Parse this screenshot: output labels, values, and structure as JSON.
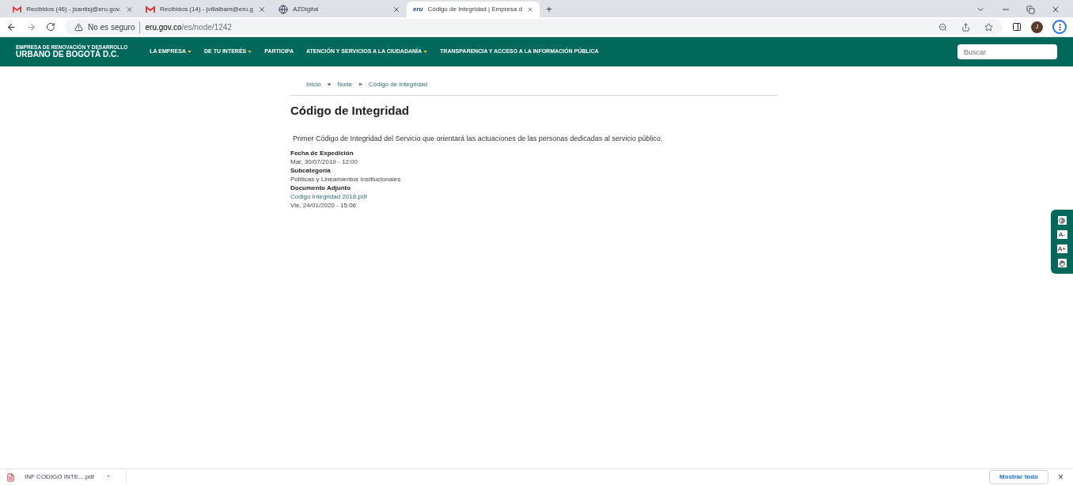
{
  "browser": {
    "tabs": [
      {
        "title": "Recibidos (46) - jsantisj@eru.gov.",
        "kind": "mail",
        "selected": false
      },
      {
        "title": "Recibidos (14) - jvillalbam@eru.g",
        "kind": "mail",
        "selected": false
      },
      {
        "title": "AZDigital",
        "kind": "globe",
        "selected": false
      },
      {
        "title": "Código de Integridad | Empresa d",
        "kind": "site",
        "favicon_text": "eru",
        "selected": true
      }
    ],
    "new_tab": "+",
    "security": "No es seguro",
    "url_host": "eru.gov.co",
    "url_path": "/es/node/1242",
    "avatar": "J"
  },
  "site": {
    "logo_top": "EMPRESA DE RENOVACIÓN Y DESARROLLO",
    "logo_bottom": "URBANO DE BOGOTÁ D.C.",
    "nav": [
      {
        "label": "LA EMPRESA",
        "dropdown": true
      },
      {
        "label": "DE TU INTERÉS",
        "dropdown": true
      },
      {
        "label": "PARTICIPA",
        "dropdown": false
      },
      {
        "label": "ATENCIÓN Y SERVICIOS A LA CIUDADANÍA",
        "dropdown": true
      },
      {
        "label": "TRANSPARENCIA Y ACCESO A LA INFORMACIÓN PÚBLICA",
        "dropdown": false
      }
    ],
    "search": {
      "placeholder": "Buscar"
    }
  },
  "breadcrumb": [
    {
      "label": "Inicio",
      "sep": "»"
    },
    {
      "label": "Node",
      "sep": "»"
    },
    {
      "label": "Código de Integridad"
    }
  ],
  "page": {
    "title": "Código de Integridad",
    "summary": "Primer Código de Integridad del Servicio que orientará las actuaciones de las personas dedicadas al servicio público.",
    "fields": [
      {
        "label": "Fecha de Expedición",
        "values": [
          {
            "text": "Mar, 30/07/2019 - 12:00",
            "kind": "text"
          }
        ]
      },
      {
        "label": "Subcategoría",
        "values": [
          {
            "text": "Políticas y Lineamientos Institucionales",
            "kind": "text"
          }
        ]
      },
      {
        "label": "Documento Adjunto",
        "values": [
          {
            "text": "Codigo Integridad 2018.pdf",
            "kind": "link"
          },
          {
            "text": "Vie, 24/01/2020 - 15:06",
            "kind": "text"
          }
        ]
      }
    ]
  },
  "accessibility": [
    {
      "kind": "contrast"
    },
    {
      "kind": "text",
      "label": "A-"
    },
    {
      "kind": "text",
      "label": "A+"
    },
    {
      "kind": "sign"
    }
  ],
  "download_bar": {
    "file": "INF CODIGO INTE....pdf",
    "caret": "^",
    "show_all": "Mostrar todo",
    "close": "×"
  }
}
